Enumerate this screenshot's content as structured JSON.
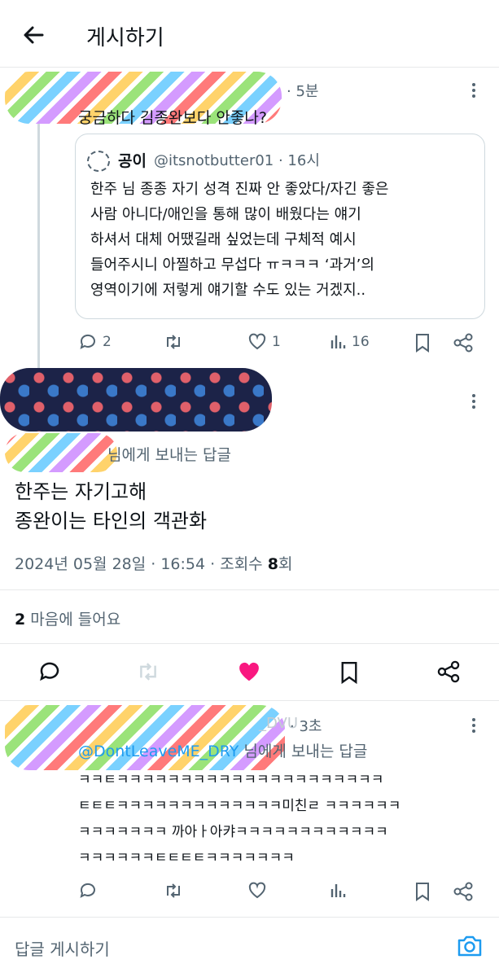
{
  "header": {
    "title": "게시하기"
  },
  "post1": {
    "meta": "· 5분",
    "text": "궁금하다 김종완보다 안좋나?",
    "quote": {
      "name": "공이",
      "meta": "@itsnotbutter01 · 16시",
      "lines": [
        "한주 님 종종 자기 성격 진짜 안 좋았다/자긴 좋은",
        "사람 아니다/애인을 통해 많이 배웠다는 얘기",
        "하셔서 대체 어땠길래 싶었는데 구체적 예시",
        "들어주시니 아찔하고 무섭다 ㅠㅋㅋㅋ ‘과거’의",
        "영역이기에 저렇게 얘기할 수도 있는 거겠지.."
      ]
    },
    "actions": {
      "replies": "2",
      "likes": "1",
      "views": "16"
    }
  },
  "main_post": {
    "reply_to": "님에게 보내는 답글",
    "lines": [
      "한주는 자기고해",
      "종완이는 타인의 객관화"
    ],
    "date": "2024년 05월 28일 · 16:54 · 조회수 ",
    "views": "8",
    "views_suffix": "회",
    "likes_count": "2",
    "likes_label": " 마음에 들어요"
  },
  "reply": {
    "meta_partial": "_DVU",
    "meta": "· 3초",
    "mention": "@DontLeaveME_DRY",
    "reply_to_suffix": " 님에게 보내는 답글",
    "lines": [
      "ㅋㅋㅌㅋㅋㅋㅋㅋㅋㅋㅋㅋㅋㅋㅋㅋㅋㅋㅋㅋㅋㅋㅋㅋ",
      "ㅌㅌㅌㅋㅋㅋㅋㅋㅋㅋㅋㅋㅋㅋㅋㅋ미친ㄹ ㅋㅋㅋㅋㅋㅋ",
      "ㅋㅋㅋㅋㅋㅋㅋ 까아ㅏ아캬ㅋㅋㅋㅋㅋㅋㅋㅋㅋㅋㅋㅋ",
      "ㅋㅋㅋㅋㅋㅋㅌㅌㅌㅌㅋㅋㅋㅋㅋㅋㅋ"
    ]
  },
  "composer": {
    "placeholder": "답글 게시하기"
  },
  "colors": {
    "like": "#f91880",
    "link": "#1d9bf0",
    "muted": "#536471"
  }
}
